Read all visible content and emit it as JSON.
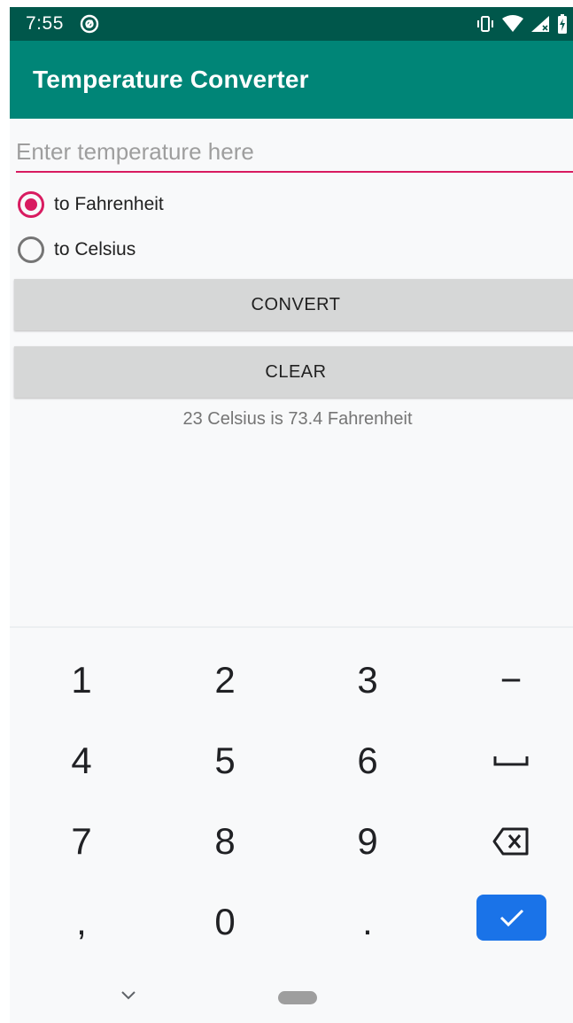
{
  "status_bar": {
    "time": "7:55",
    "icons": [
      "vibrate-icon",
      "wifi-icon",
      "cell-signal-icon",
      "battery-charging-icon"
    ]
  },
  "app_bar": {
    "title": "Temperature Converter"
  },
  "form": {
    "input_placeholder": "Enter temperature here",
    "input_value": "",
    "radio_fahrenheit": {
      "label": "to Fahrenheit",
      "checked": true
    },
    "radio_celsius": {
      "label": "to Celsius",
      "checked": false
    },
    "convert_label": "CONVERT",
    "clear_label": "CLEAR",
    "result": "23 Celsius is 73.4 Fahrenheit"
  },
  "keyboard": {
    "row1": [
      "1",
      "2",
      "3",
      "−"
    ],
    "row2": [
      "4",
      "5",
      "6"
    ],
    "row3": [
      "7",
      "8",
      "9"
    ],
    "row4": [
      ",",
      "0",
      "."
    ],
    "special_keys": [
      "space-key-icon",
      "backspace-icon",
      "checkmark-icon"
    ]
  },
  "colors": {
    "primary": "#008577",
    "primary_dark": "#00574b",
    "accent": "#d81b60",
    "done_key": "#1a73e8"
  }
}
